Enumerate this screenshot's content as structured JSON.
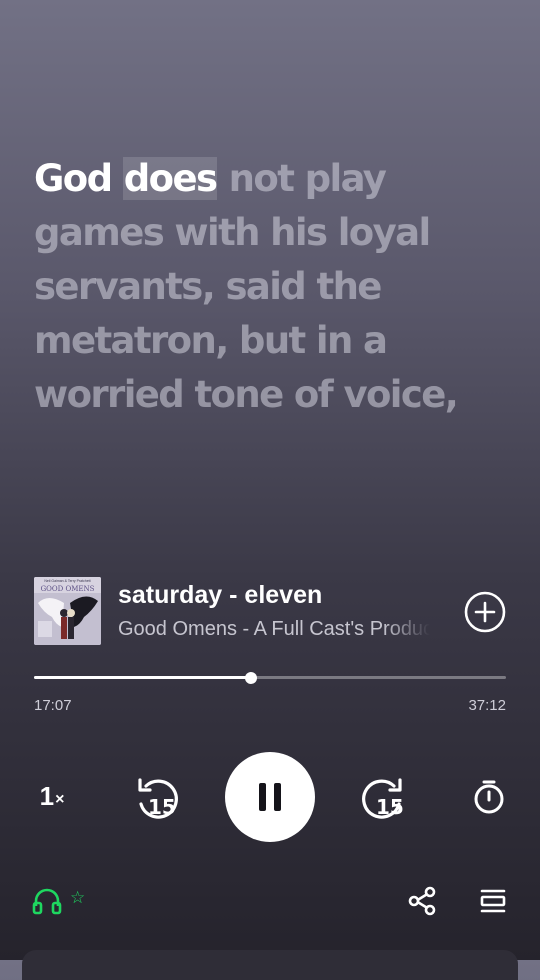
{
  "lyrics": {
    "lines": [
      {
        "sung": "God ",
        "current": "does",
        "unsung": " not play"
      },
      {
        "unsung": "games with his loyal"
      },
      {
        "unsung": "servants, said the"
      },
      {
        "unsung": "metatron, but in a"
      },
      {
        "unsung": "worried tone of voice,"
      }
    ]
  },
  "now_playing": {
    "title": "saturday - eleven",
    "subtitle": "Good Omens - A Full Cast's Production",
    "cover_text": "GOOD OMENS",
    "cover_authors": "Neil Gaiman & Terry Pratchett"
  },
  "progress": {
    "elapsed": "17:07",
    "total": "37:12",
    "fraction": 0.46
  },
  "controls": {
    "speed": "1",
    "speed_suffix": "×",
    "skip_back": "15",
    "skip_forward": "15"
  },
  "icons": {
    "device": "headphones-icon",
    "share": "share-icon",
    "queue": "queue-icon",
    "timer": "sleep-timer-icon",
    "add": "add-circle-icon"
  },
  "colors": {
    "accent": "#1ed760",
    "play_button": "#ffffff"
  }
}
